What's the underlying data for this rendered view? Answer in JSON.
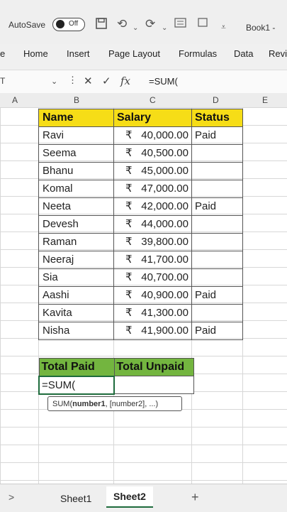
{
  "titlebar": {
    "autosave_label": "AutoSave",
    "toggle_state": "Off",
    "book_title": "Book1 -"
  },
  "ribbon": {
    "tabs": [
      "e",
      "Home",
      "Insert",
      "Page Layout",
      "Formulas",
      "Data",
      "Revi"
    ]
  },
  "formula_bar": {
    "name_box": "T",
    "formula": "=SUM("
  },
  "columns": [
    "A",
    "B",
    "C",
    "D",
    "E"
  ],
  "table": {
    "headers": {
      "name": "Name",
      "salary": "Salary",
      "status": "Status"
    },
    "currency": "₹",
    "rows": [
      {
        "name": "Ravi",
        "salary": "40,000.00",
        "status": "Paid"
      },
      {
        "name": "Seema",
        "salary": "40,500.00",
        "status": ""
      },
      {
        "name": "Bhanu",
        "salary": "45,000.00",
        "status": ""
      },
      {
        "name": "Komal",
        "salary": "47,000.00",
        "status": ""
      },
      {
        "name": "Neeta",
        "salary": "42,000.00",
        "status": "Paid"
      },
      {
        "name": "Devesh",
        "salary": "44,000.00",
        "status": ""
      },
      {
        "name": "Raman",
        "salary": "39,800.00",
        "status": ""
      },
      {
        "name": "Neeraj",
        "salary": "41,700.00",
        "status": ""
      },
      {
        "name": "Sia",
        "salary": "40,700.00",
        "status": ""
      },
      {
        "name": "Aashi",
        "salary": "40,900.00",
        "status": "Paid"
      },
      {
        "name": "Kavita",
        "salary": "41,300.00",
        "status": ""
      },
      {
        "name": "Nisha",
        "salary": "41,900.00",
        "status": "Paid"
      }
    ]
  },
  "totals": {
    "paid_label": "Total Paid",
    "unpaid_label": "Total Unpaid",
    "paid_value": "=SUM(",
    "unpaid_value": ""
  },
  "tooltip": {
    "fn": "SUM(",
    "arg1": "number1",
    "rest": ", [number2], ...)"
  },
  "sheets": {
    "tabs": [
      "Sheet1",
      "Sheet2"
    ],
    "active": "Sheet2",
    "add": "+",
    "nav": ">"
  },
  "colors": {
    "header_yellow": "#f6dd17",
    "totals_green": "#73b53f",
    "excel_green": "#1e6b3c"
  }
}
